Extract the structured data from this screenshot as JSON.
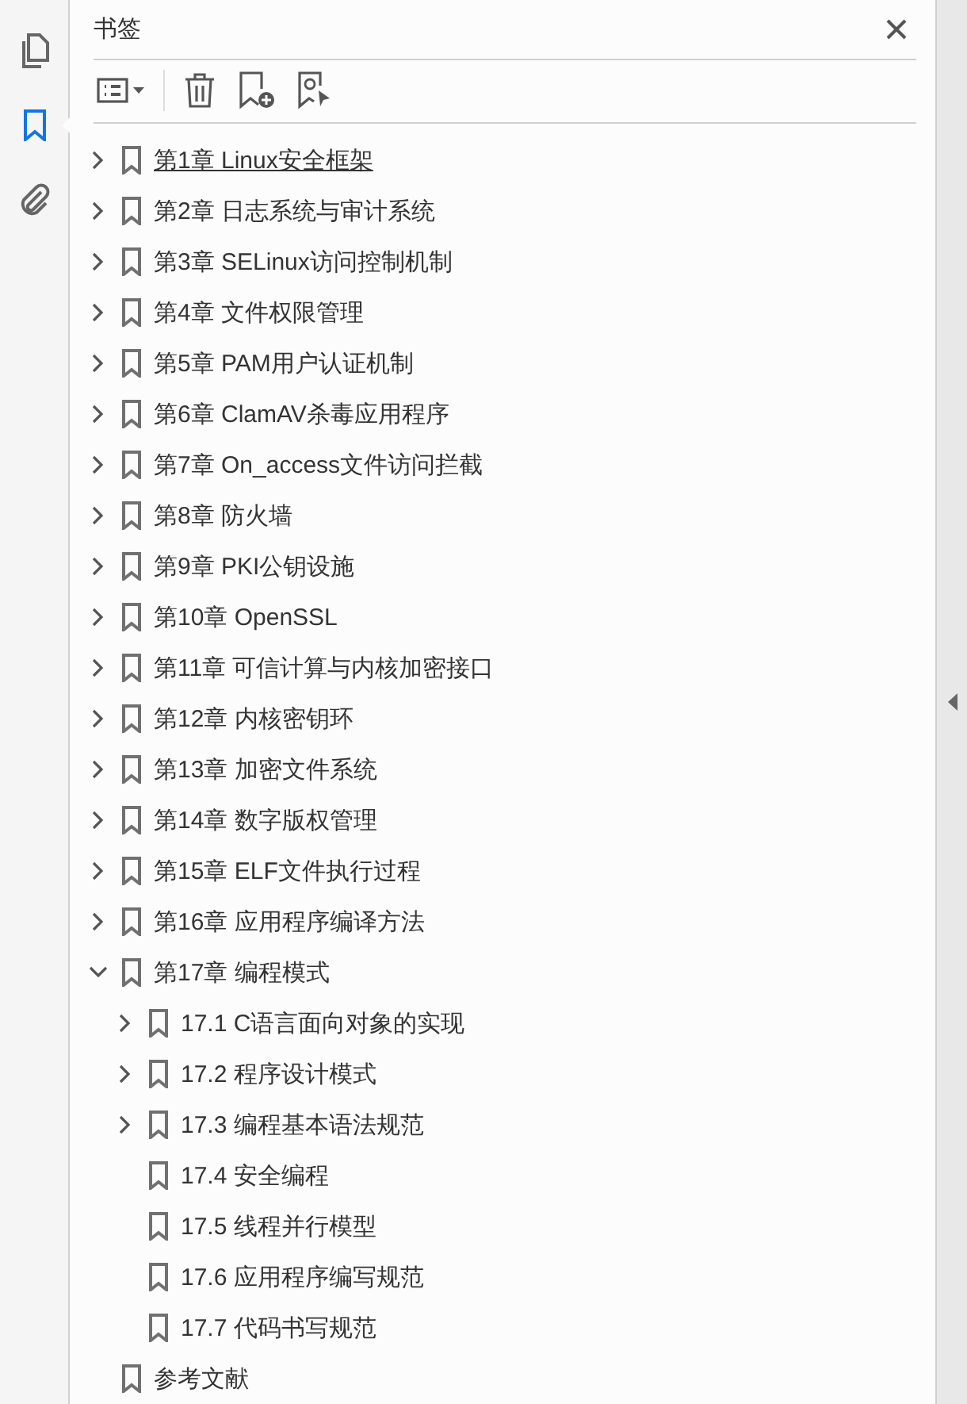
{
  "sidebar": {
    "items": [
      {
        "selected": false
      },
      {
        "selected": true
      },
      {
        "selected": false
      }
    ]
  },
  "panel": {
    "title": "书签"
  },
  "bookmarks": [
    {
      "label": "第1章 Linux安全框架",
      "expandable": true,
      "expanded": false,
      "selected": true
    },
    {
      "label": "第2章 日志系统与审计系统",
      "expandable": true,
      "expanded": false,
      "selected": false
    },
    {
      "label": "第3章 SELinux访问控制机制",
      "expandable": true,
      "expanded": false,
      "selected": false
    },
    {
      "label": "第4章 文件权限管理",
      "expandable": true,
      "expanded": false,
      "selected": false
    },
    {
      "label": "第5章 PAM用户认证机制",
      "expandable": true,
      "expanded": false,
      "selected": false
    },
    {
      "label": "第6章 ClamAV杀毒应用程序",
      "expandable": true,
      "expanded": false,
      "selected": false
    },
    {
      "label": "第7章 On_access文件访问拦截",
      "expandable": true,
      "expanded": false,
      "selected": false
    },
    {
      "label": "第8章 防火墙",
      "expandable": true,
      "expanded": false,
      "selected": false
    },
    {
      "label": "第9章 PKI公钥设施",
      "expandable": true,
      "expanded": false,
      "selected": false
    },
    {
      "label": "第10章 OpenSSL",
      "expandable": true,
      "expanded": false,
      "selected": false
    },
    {
      "label": "第11章 可信计算与内核加密接口",
      "expandable": true,
      "expanded": false,
      "selected": false
    },
    {
      "label": "第12章 内核密钥环",
      "expandable": true,
      "expanded": false,
      "selected": false
    },
    {
      "label": "第13章 加密文件系统",
      "expandable": true,
      "expanded": false,
      "selected": false
    },
    {
      "label": "第14章 数字版权管理",
      "expandable": true,
      "expanded": false,
      "selected": false
    },
    {
      "label": "第15章 ELF文件执行过程",
      "expandable": true,
      "expanded": false,
      "selected": false
    },
    {
      "label": "第16章 应用程序编译方法",
      "expandable": true,
      "expanded": false,
      "selected": false
    },
    {
      "label": "第17章 编程模式",
      "expandable": true,
      "expanded": true,
      "selected": false,
      "children": [
        {
          "label": "17.1 C语言面向对象的实现",
          "expandable": true,
          "expanded": false,
          "selected": false
        },
        {
          "label": "17.2 程序设计模式",
          "expandable": true,
          "expanded": false,
          "selected": false
        },
        {
          "label": "17.3 编程基本语法规范",
          "expandable": true,
          "expanded": false,
          "selected": false
        },
        {
          "label": "17.4 安全编程",
          "expandable": false,
          "selected": false
        },
        {
          "label": "17.5 线程并行模型",
          "expandable": false,
          "selected": false
        },
        {
          "label": "17.6 应用程序编写规范",
          "expandable": false,
          "selected": false
        },
        {
          "label": "17.7 代码书写规范",
          "expandable": false,
          "selected": false
        }
      ]
    },
    {
      "label": "参考文献",
      "expandable": false,
      "selected": false
    }
  ]
}
